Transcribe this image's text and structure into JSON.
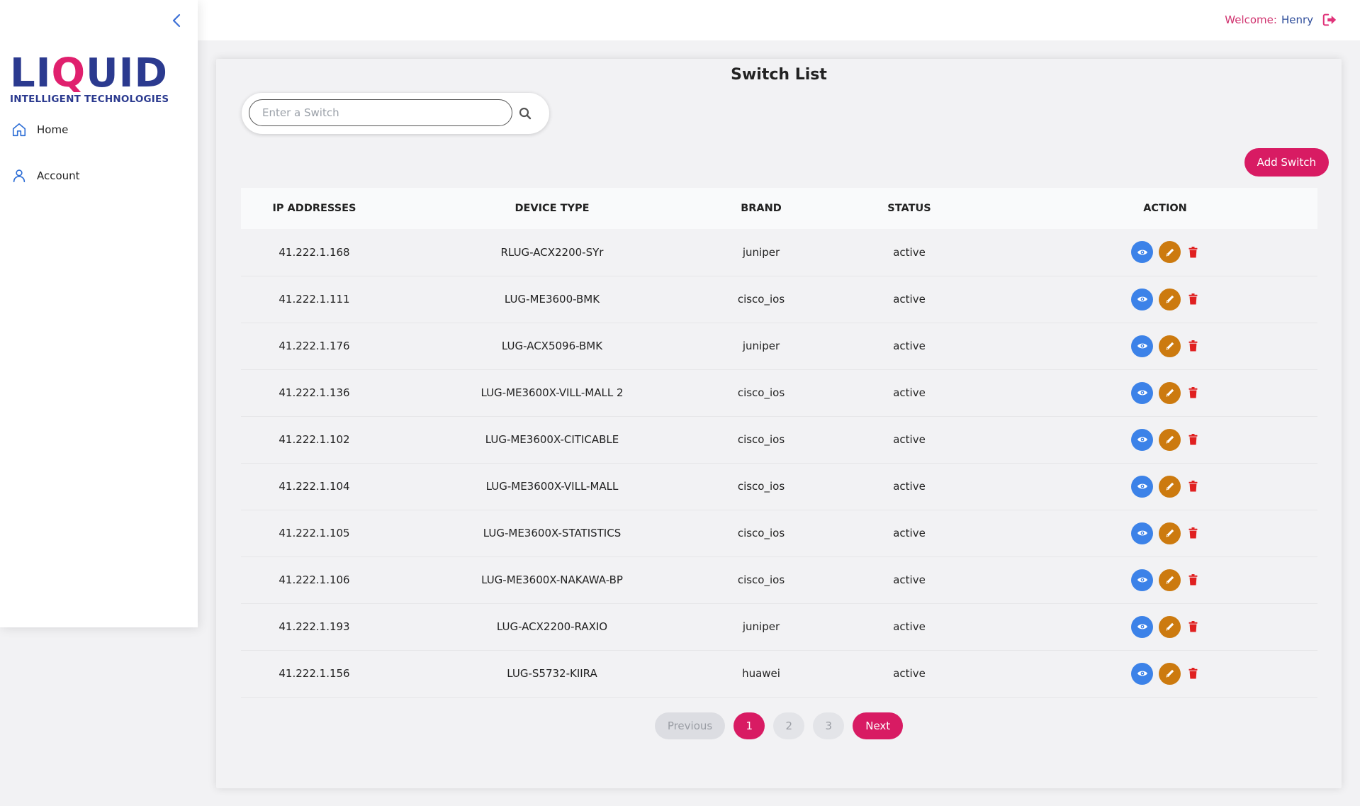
{
  "header": {
    "welcome_label": "Welcome:",
    "user_name": "Henry"
  },
  "sidebar": {
    "logo": {
      "main": "LIQUID",
      "sub": "INTELLIGENT TECHNOLOGIES"
    },
    "items": [
      {
        "label": "Home",
        "icon": "home-icon"
      },
      {
        "label": "Account",
        "icon": "user-icon"
      }
    ]
  },
  "main": {
    "title": "Switch List",
    "search": {
      "placeholder": "Enter a Switch",
      "value": ""
    },
    "add_button": "Add Switch",
    "table": {
      "headers": [
        "IP ADDRESSES",
        "DEVICE TYPE",
        "BRAND",
        "STATUS",
        "ACTION"
      ],
      "rows": [
        {
          "ip": "41.222.1.168",
          "device": "RLUG-ACX2200-SYr",
          "brand": "juniper",
          "status": "active"
        },
        {
          "ip": "41.222.1.111",
          "device": "LUG-ME3600-BMK",
          "brand": "cisco_ios",
          "status": "active"
        },
        {
          "ip": "41.222.1.176",
          "device": "LUG-ACX5096-BMK",
          "brand": "juniper",
          "status": "active"
        },
        {
          "ip": "41.222.1.136",
          "device": "LUG-ME3600X-VILL-MALL 2",
          "brand": "cisco_ios",
          "status": "active"
        },
        {
          "ip": "41.222.1.102",
          "device": "LUG-ME3600X-CITICABLE",
          "brand": "cisco_ios",
          "status": "active"
        },
        {
          "ip": "41.222.1.104",
          "device": "LUG-ME3600X-VILL-MALL",
          "brand": "cisco_ios",
          "status": "active"
        },
        {
          "ip": "41.222.1.105",
          "device": "LUG-ME3600X-STATISTICS",
          "brand": "cisco_ios",
          "status": "active"
        },
        {
          "ip": "41.222.1.106",
          "device": "LUG-ME3600X-NAKAWA-BP",
          "brand": "cisco_ios",
          "status": "active"
        },
        {
          "ip": "41.222.1.193",
          "device": "LUG-ACX2200-RAXIO",
          "brand": "juniper",
          "status": "active"
        },
        {
          "ip": "41.222.1.156",
          "device": "LUG-S5732-KIIRA",
          "brand": "huawei",
          "status": "active"
        }
      ]
    },
    "pagination": {
      "previous": "Previous",
      "pages": [
        "1",
        "2",
        "3"
      ],
      "current": "1",
      "next": "Next"
    }
  },
  "colors": {
    "accent": "#d81b63",
    "brand_blue": "#2b3a8f",
    "view": "#3c82e8",
    "edit": "#cc7a0f",
    "delete": "#e02020",
    "status_active": "#2e9d2e"
  }
}
